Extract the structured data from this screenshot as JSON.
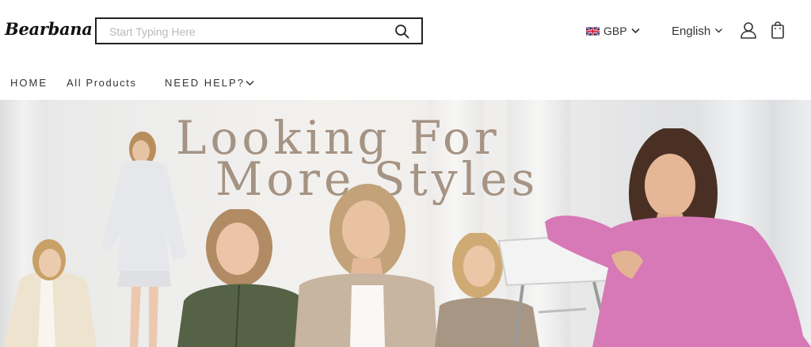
{
  "header": {
    "logo": "Bearbana",
    "search": {
      "placeholder": "Start Typing Here",
      "value": ""
    },
    "currency": {
      "label": "GBP",
      "flag": "uk-flag-icon"
    },
    "language": {
      "label": "English"
    },
    "icons": [
      "search-icon",
      "user-icon",
      "shopping-bag-icon",
      "chevron-down-icon"
    ]
  },
  "nav": {
    "items": [
      {
        "label": "HOME"
      },
      {
        "label": "All Products"
      },
      {
        "label": "NEED HELP?"
      }
    ]
  },
  "banner": {
    "title_line1": "Looking For",
    "title_line2": "More  Styles",
    "colors": {
      "title": "#a59383",
      "background": "#efeeec"
    }
  }
}
